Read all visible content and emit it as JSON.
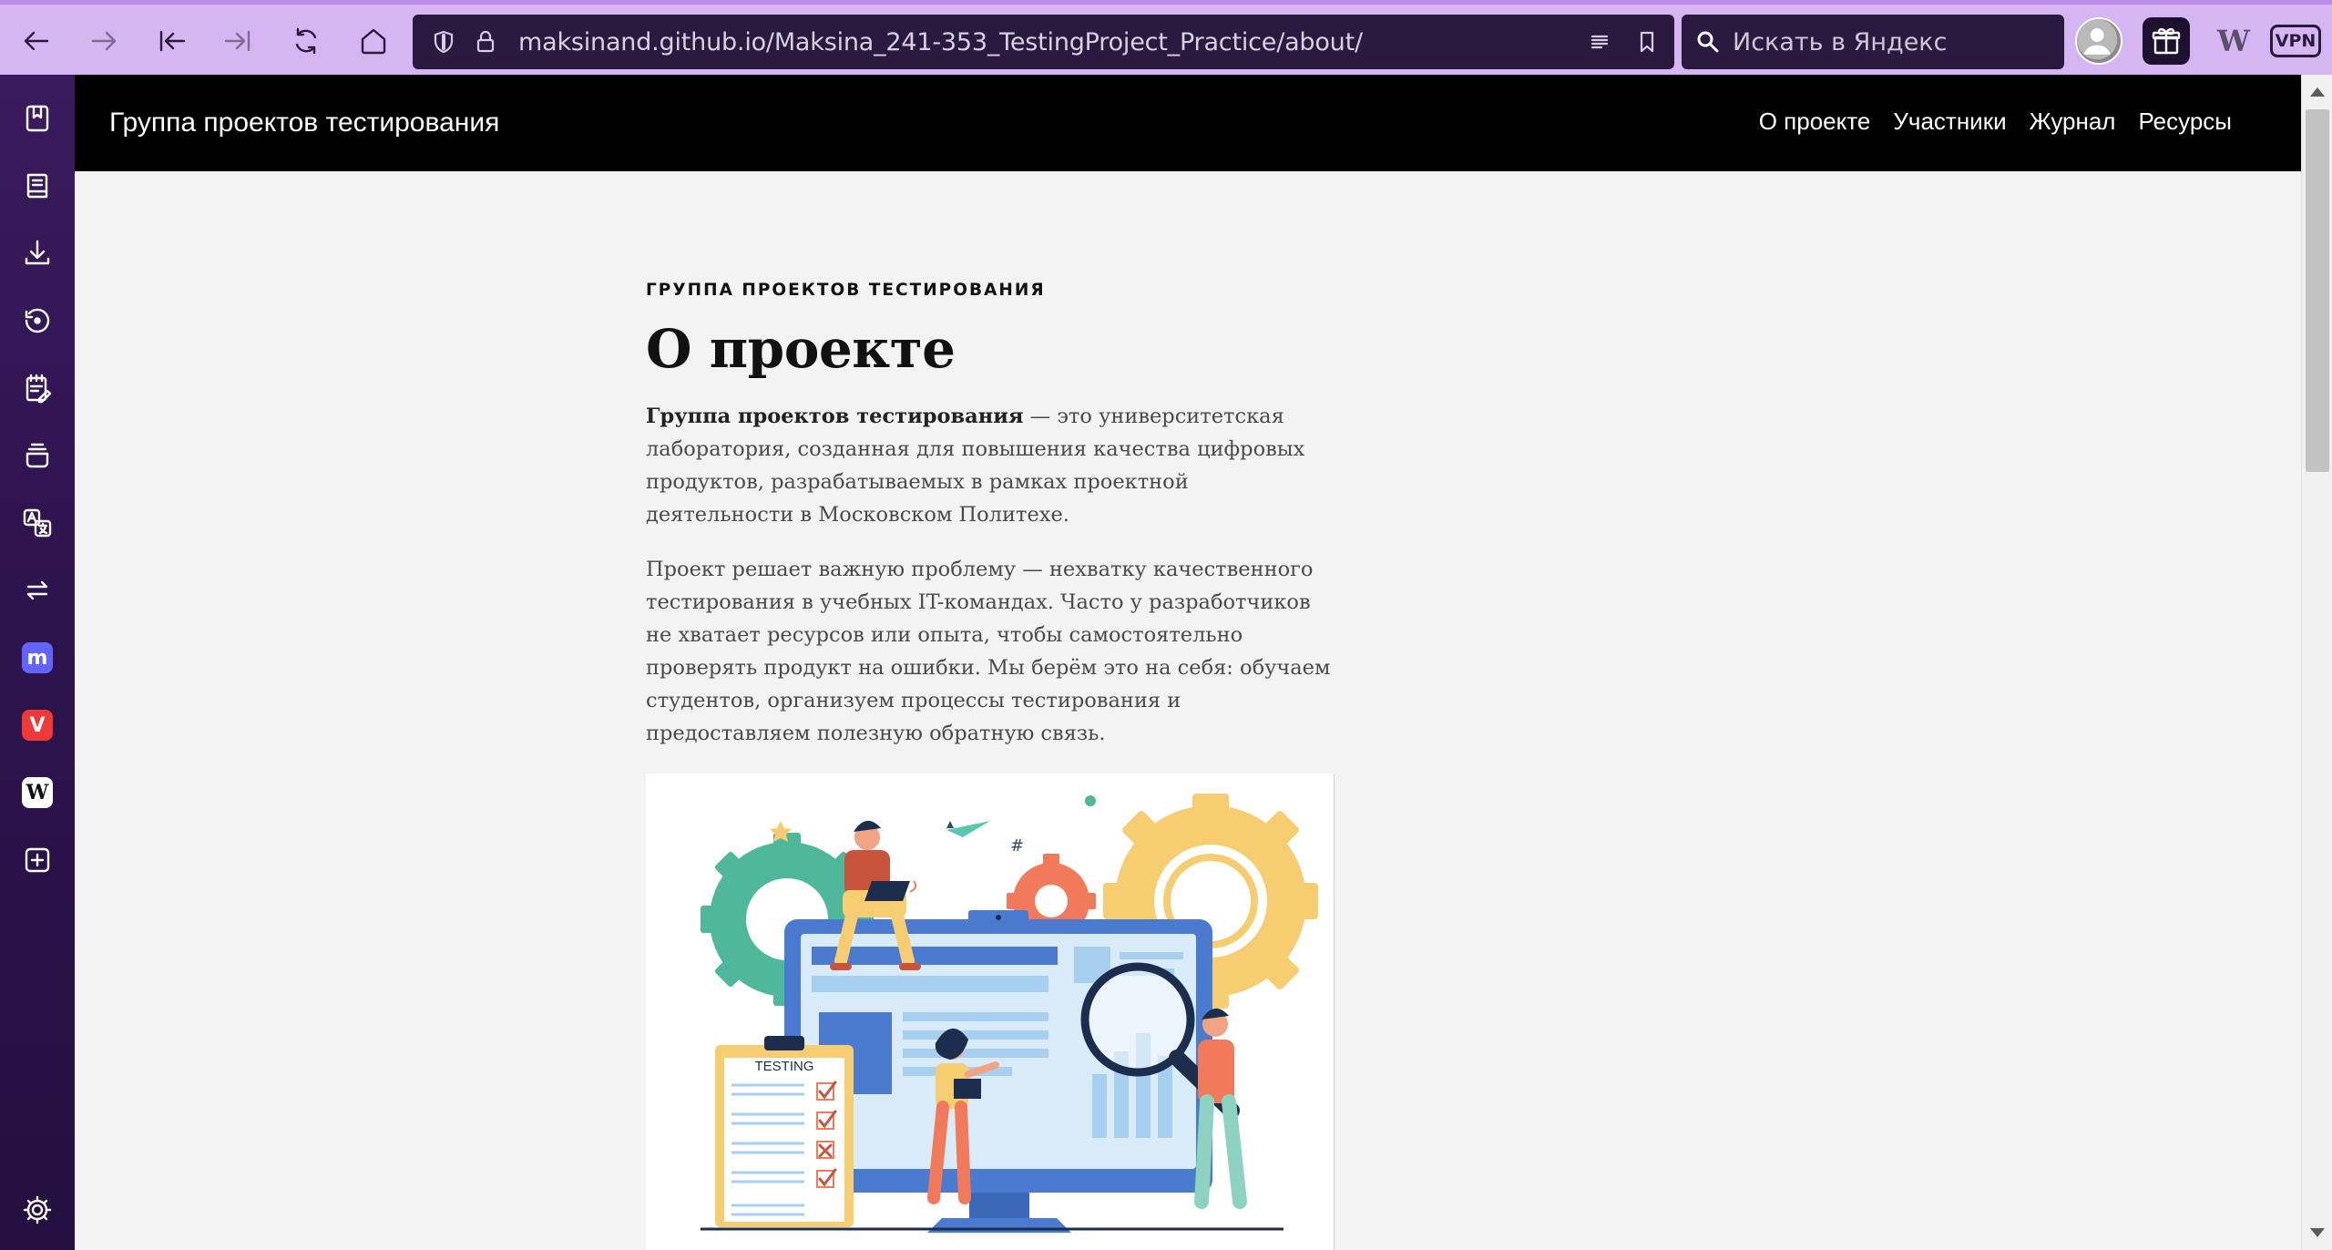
{
  "browser": {
    "url": "maksinand.github.io/Maksina_241-353_TestingProject_Practice/about/",
    "search_placeholder": "Искать в Яндекс",
    "vpn_label": "VPN",
    "wiki_label": "W"
  },
  "toolbar_icons": [
    "back-icon",
    "forward-icon",
    "first-page-icon",
    "last-page-icon",
    "reload-icon",
    "home-icon",
    "shield-icon",
    "lock-icon",
    "reader-mode-icon",
    "bookmark-icon",
    "search-icon",
    "profile-avatar",
    "gift-icon",
    "wiki-icon",
    "vpn-icon"
  ],
  "sidebar_icons": [
    "bookmarks-icon",
    "reading-list-icon",
    "downloads-icon",
    "history-icon",
    "notes-icon",
    "window-stack-icon",
    "translate-icon",
    "sync-icon",
    "mastodon-icon",
    "vivaldi-icon",
    "wikipedia-icon",
    "add-panel-icon",
    "settings-icon"
  ],
  "colors": {
    "toolbar": "#d5b6f2",
    "sidebar": "#2f1450",
    "address_bar": "#2b1a40",
    "site_header": "#000000",
    "page_bg": "#f3f3f3"
  },
  "site": {
    "title": "Группа проектов тестирования",
    "nav": [
      "О проекте",
      "Участники",
      "Журнал",
      "Ресурсы"
    ]
  },
  "page": {
    "kicker": "ГРУППА ПРОЕКТОВ ТЕСТИРОВАНИЯ",
    "title": "О проекте",
    "para1_bold": "Группа проектов тестирования",
    "para1_rest": " — это университетская лаборатория, созданная для повышения качества цифровых продуктов, разрабатываемых в рамках проектной деятельности в Московском Политехе.",
    "para2": "Проект решает важную проблему — нехватку качественного тестирования в учебных IT-командах. Часто у разработчиков не хватает ресурсов или опыта, чтобы самостоятельно проверять продукт на ошибки. Мы берём это на себя: обучаем студентов, организуем процессы тестирования и предоставляем полезную обратную связь.",
    "illustration_label": "TESTING"
  }
}
